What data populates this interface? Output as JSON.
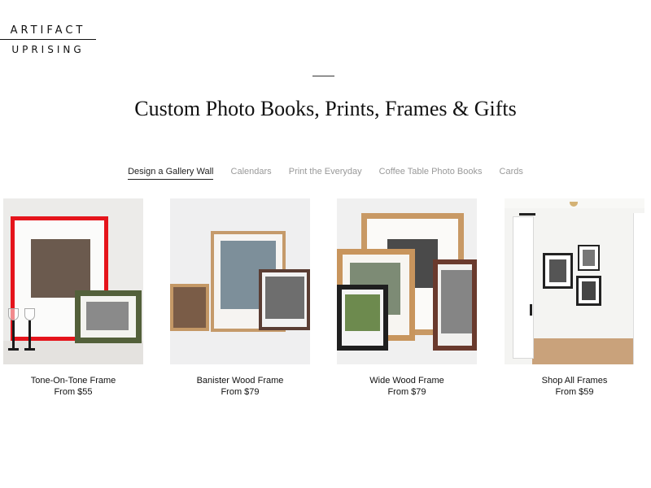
{
  "logo": {
    "line1": "ARTIFACT",
    "line2": "UPRISING"
  },
  "page_title": "Custom Photo Books, Prints, Frames & Gifts",
  "tabs": [
    {
      "label": "Design a Gallery Wall",
      "active": true
    },
    {
      "label": "Calendars",
      "active": false
    },
    {
      "label": "Print the Everyday",
      "active": false
    },
    {
      "label": "Coffee Table Photo Books",
      "active": false
    },
    {
      "label": "Cards",
      "active": false
    }
  ],
  "products": [
    {
      "name": "Tone-On-Tone Frame",
      "price": "From $55"
    },
    {
      "name": "Banister Wood Frame",
      "price": "From $79"
    },
    {
      "name": "Wide Wood Frame",
      "price": "From $79"
    },
    {
      "name": "Shop All Frames",
      "price": "From $59"
    }
  ],
  "colors": {
    "accent_tab_underline": "#222222",
    "inactive_tab": "#999999",
    "red_frame": "#e5141b"
  }
}
